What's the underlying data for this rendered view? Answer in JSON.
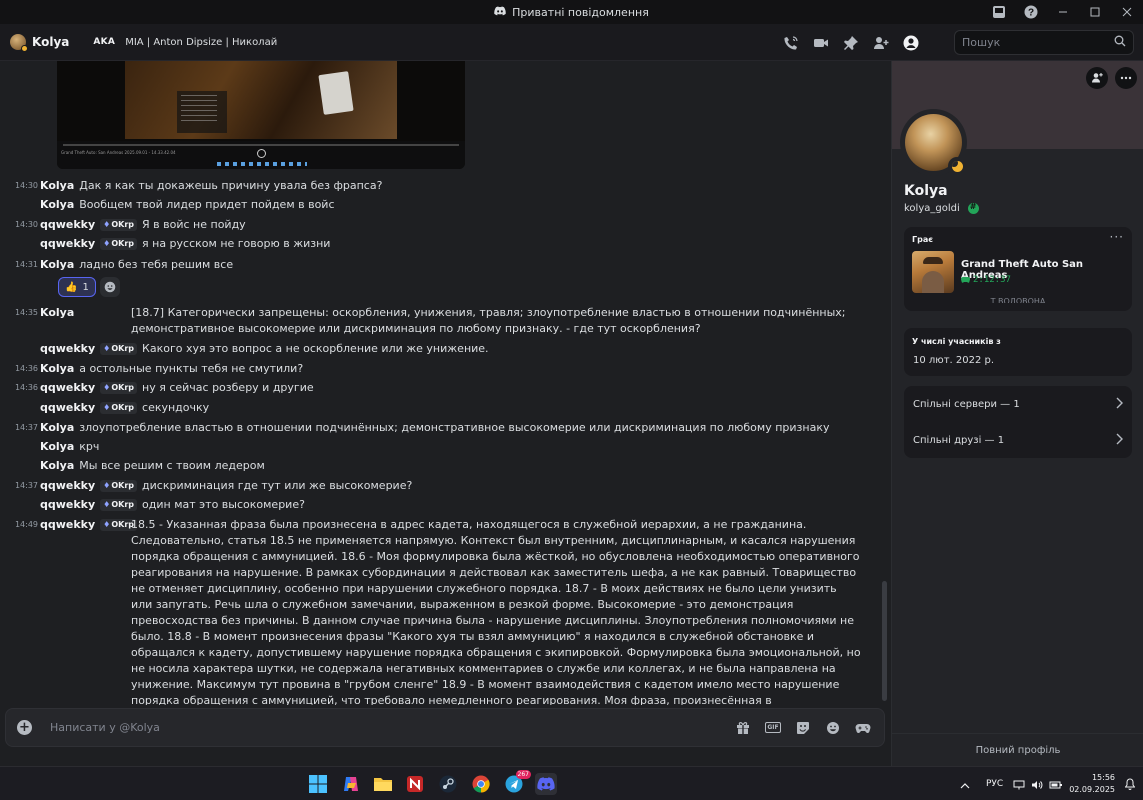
{
  "window": {
    "title": "Приватні повідомлення"
  },
  "header": {
    "name": "Kolya",
    "aka_label": "AKA",
    "aliases": "MIA | Anton Dipsize | Николай",
    "search_placeholder": "Пошук"
  },
  "video": {
    "title": "Grand Theft Auto: San Andreas 2025.09.01 - 14.33.42.04"
  },
  "messages": [
    {
      "time": "14:30",
      "author": "Kolya",
      "text": "Дак я как ты докажешь причину увала без фрапса?"
    },
    {
      "time": "",
      "author": "Kolya",
      "text": "Вообщем твой лидер придет пойдем в войс"
    },
    {
      "time": "14:30",
      "author": "qqwekky",
      "clan": "OKrp",
      "text": "Я в войс не пойду"
    },
    {
      "time": "",
      "author": "qqwekky",
      "clan": "OKrp",
      "text": "я на русском не говорю в жизни"
    },
    {
      "time": "14:31",
      "author": "Kolya",
      "text": "ладно без тебя решим все"
    },
    {
      "time": "14:35",
      "author": "Kolya",
      "text": "[18.7] Категорически запрещены: оскорбления, унижения, травля; злоупотребление властью в отношении подчинённых; демонстративное высокомерие или дискриминация по любому признаку. - где тут оскорбления?"
    },
    {
      "time": "",
      "author": "qqwekky",
      "clan": "OKrp",
      "text": "Какого хуя это вопрос а не оскорбление или же унижение."
    },
    {
      "time": "14:36",
      "author": "Kolya",
      "text": "а остольные пункты тебя не смутили?"
    },
    {
      "time": "14:36",
      "author": "qqwekky",
      "clan": "OKrp",
      "text": "ну я сейчас розберу и другие"
    },
    {
      "time": "",
      "author": "qqwekky",
      "clan": "OKrp",
      "text": "секундочку"
    },
    {
      "time": "14:37",
      "author": "Kolya",
      "text": "злоупотребление властью в отношении подчинённых; демонстративное высокомерие или дискриминация по любому признаку"
    },
    {
      "time": "",
      "author": "Kolya",
      "text": "крч"
    },
    {
      "time": "",
      "author": "Kolya",
      "text": "Мы все решим с твоим ледером"
    },
    {
      "time": "14:37",
      "author": "qqwekky",
      "clan": "OKrp",
      "text": "дискриминация где тут или же высокомерие?"
    },
    {
      "time": "",
      "author": "qqwekky",
      "clan": "OKrp",
      "text": "один мат это высокомерие?"
    },
    {
      "time": "14:49",
      "author": "qqwekky",
      "clan": "OKrp",
      "text": "18.5 -  Указанная фраза была произнесена в адрес кадета, находящегося в служебной иерархии, а не гражданина. Следовательно, статья 18.5 не применяется напрямую. Контекст был внутренним, дисциплинарным, и касался нарушения порядка обращения с аммуницией. 18.6 - Моя формулировка была жёсткой, но обусловлена необходимостью оперативного реагирования на нарушение. В рамках субординации я действовал как заместитель шефа, а не как равный. Товарищество не отменяет дисциплину, особенно при нарушении служебного порядка. 18.7 - В моих действиях не было цели унизить или запугать. Речь шла о служебном замечании, выраженном в резкой форме. Высокомерие - это демонстрация превосходства без причины. В данном случае причина была - нарушение дисциплины. Злоупотребления полномочиями не было. 18.8 - В момент произнесения фразы \"Какого хуя ты взял аммуницию\" я находился в служебной обстановке и обращался к кадету, допустившему нарушение порядка обращения с экипировкой. Формулировка была эмоциональной, но не носила характера шутки, не содержала негативных комментариев о службе или коллегах, и не была направлена на унижение. Максимум тут провина в \"грубом сленге\" 18.9 - В момент взаимодействия с кадетом имело место нарушение порядка обращения с аммуницией, что требовало немедленного реагирования. Моя фраза, произнесённая в эмоциональной форме, была направлена исключительно на пресечение служебного нарушения и не сопровождалась агрессией, угрозами или действиями, выходящими за рамки полномочий."
    }
  ],
  "reaction": {
    "emoji": "👍",
    "count": "1"
  },
  "composer": {
    "placeholder": "Написати у @Kolya",
    "gif_label": "GIF"
  },
  "profile": {
    "name": "Kolya",
    "username": "kolya_goldi",
    "activity": {
      "label": "Грає",
      "game": "Grand Theft Auto San Andreas",
      "elapsed": "2:12:37",
      "cutoff": "Т ВОЛОВОНА"
    },
    "member_since_label": "У числі учасників з",
    "member_since": "10 лют. 2022 р.",
    "mutual_servers": "Спільні сервери — 1",
    "mutual_friends": "Спільні друзі — 1",
    "full_profile": "Повний профіль"
  },
  "taskbar": {
    "telegram_badge": "267",
    "language": "РУС",
    "time": "15:56",
    "date": "02.09.2025"
  },
  "colors": {
    "accent": "#5865f2",
    "idle": "#f0b232",
    "online_green": "#23a559"
  }
}
